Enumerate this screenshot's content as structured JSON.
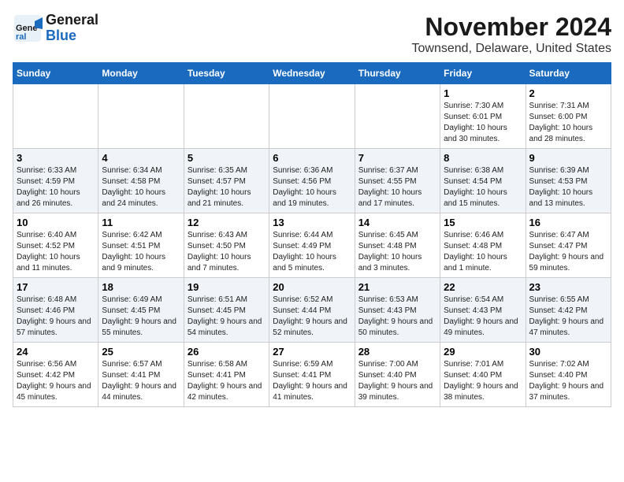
{
  "logo": {
    "line1": "General",
    "line2": "Blue"
  },
  "title": "November 2024",
  "subtitle": "Townsend, Delaware, United States",
  "weekdays": [
    "Sunday",
    "Monday",
    "Tuesday",
    "Wednesday",
    "Thursday",
    "Friday",
    "Saturday"
  ],
  "weeks": [
    [
      {
        "day": "",
        "info": ""
      },
      {
        "day": "",
        "info": ""
      },
      {
        "day": "",
        "info": ""
      },
      {
        "day": "",
        "info": ""
      },
      {
        "day": "",
        "info": ""
      },
      {
        "day": "1",
        "info": "Sunrise: 7:30 AM\nSunset: 6:01 PM\nDaylight: 10 hours and 30 minutes."
      },
      {
        "day": "2",
        "info": "Sunrise: 7:31 AM\nSunset: 6:00 PM\nDaylight: 10 hours and 28 minutes."
      }
    ],
    [
      {
        "day": "3",
        "info": "Sunrise: 6:33 AM\nSunset: 4:59 PM\nDaylight: 10 hours and 26 minutes."
      },
      {
        "day": "4",
        "info": "Sunrise: 6:34 AM\nSunset: 4:58 PM\nDaylight: 10 hours and 24 minutes."
      },
      {
        "day": "5",
        "info": "Sunrise: 6:35 AM\nSunset: 4:57 PM\nDaylight: 10 hours and 21 minutes."
      },
      {
        "day": "6",
        "info": "Sunrise: 6:36 AM\nSunset: 4:56 PM\nDaylight: 10 hours and 19 minutes."
      },
      {
        "day": "7",
        "info": "Sunrise: 6:37 AM\nSunset: 4:55 PM\nDaylight: 10 hours and 17 minutes."
      },
      {
        "day": "8",
        "info": "Sunrise: 6:38 AM\nSunset: 4:54 PM\nDaylight: 10 hours and 15 minutes."
      },
      {
        "day": "9",
        "info": "Sunrise: 6:39 AM\nSunset: 4:53 PM\nDaylight: 10 hours and 13 minutes."
      }
    ],
    [
      {
        "day": "10",
        "info": "Sunrise: 6:40 AM\nSunset: 4:52 PM\nDaylight: 10 hours and 11 minutes."
      },
      {
        "day": "11",
        "info": "Sunrise: 6:42 AM\nSunset: 4:51 PM\nDaylight: 10 hours and 9 minutes."
      },
      {
        "day": "12",
        "info": "Sunrise: 6:43 AM\nSunset: 4:50 PM\nDaylight: 10 hours and 7 minutes."
      },
      {
        "day": "13",
        "info": "Sunrise: 6:44 AM\nSunset: 4:49 PM\nDaylight: 10 hours and 5 minutes."
      },
      {
        "day": "14",
        "info": "Sunrise: 6:45 AM\nSunset: 4:48 PM\nDaylight: 10 hours and 3 minutes."
      },
      {
        "day": "15",
        "info": "Sunrise: 6:46 AM\nSunset: 4:48 PM\nDaylight: 10 hours and 1 minute."
      },
      {
        "day": "16",
        "info": "Sunrise: 6:47 AM\nSunset: 4:47 PM\nDaylight: 9 hours and 59 minutes."
      }
    ],
    [
      {
        "day": "17",
        "info": "Sunrise: 6:48 AM\nSunset: 4:46 PM\nDaylight: 9 hours and 57 minutes."
      },
      {
        "day": "18",
        "info": "Sunrise: 6:49 AM\nSunset: 4:45 PM\nDaylight: 9 hours and 55 minutes."
      },
      {
        "day": "19",
        "info": "Sunrise: 6:51 AM\nSunset: 4:45 PM\nDaylight: 9 hours and 54 minutes."
      },
      {
        "day": "20",
        "info": "Sunrise: 6:52 AM\nSunset: 4:44 PM\nDaylight: 9 hours and 52 minutes."
      },
      {
        "day": "21",
        "info": "Sunrise: 6:53 AM\nSunset: 4:43 PM\nDaylight: 9 hours and 50 minutes."
      },
      {
        "day": "22",
        "info": "Sunrise: 6:54 AM\nSunset: 4:43 PM\nDaylight: 9 hours and 49 minutes."
      },
      {
        "day": "23",
        "info": "Sunrise: 6:55 AM\nSunset: 4:42 PM\nDaylight: 9 hours and 47 minutes."
      }
    ],
    [
      {
        "day": "24",
        "info": "Sunrise: 6:56 AM\nSunset: 4:42 PM\nDaylight: 9 hours and 45 minutes."
      },
      {
        "day": "25",
        "info": "Sunrise: 6:57 AM\nSunset: 4:41 PM\nDaylight: 9 hours and 44 minutes."
      },
      {
        "day": "26",
        "info": "Sunrise: 6:58 AM\nSunset: 4:41 PM\nDaylight: 9 hours and 42 minutes."
      },
      {
        "day": "27",
        "info": "Sunrise: 6:59 AM\nSunset: 4:41 PM\nDaylight: 9 hours and 41 minutes."
      },
      {
        "day": "28",
        "info": "Sunrise: 7:00 AM\nSunset: 4:40 PM\nDaylight: 9 hours and 39 minutes."
      },
      {
        "day": "29",
        "info": "Sunrise: 7:01 AM\nSunset: 4:40 PM\nDaylight: 9 hours and 38 minutes."
      },
      {
        "day": "30",
        "info": "Sunrise: 7:02 AM\nSunset: 4:40 PM\nDaylight: 9 hours and 37 minutes."
      }
    ]
  ]
}
